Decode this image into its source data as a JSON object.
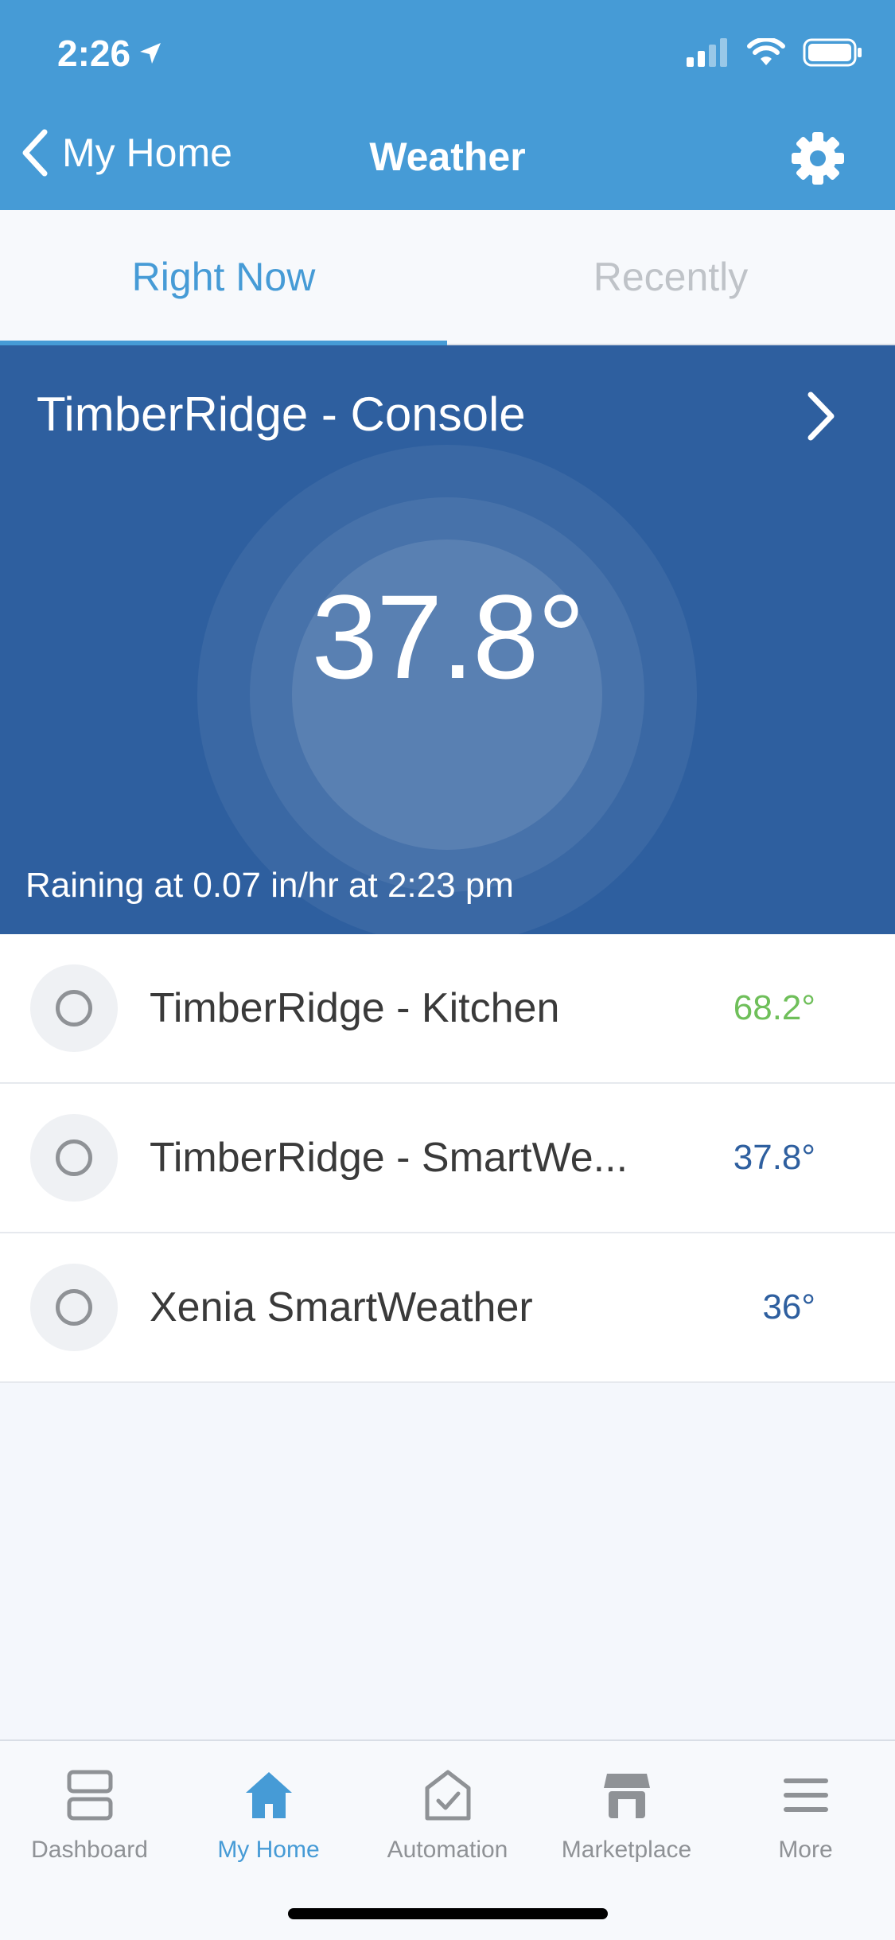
{
  "status": {
    "time": "2:26"
  },
  "nav": {
    "back_label": "My Home",
    "title": "Weather"
  },
  "tabs": {
    "active": "Right Now",
    "inactive": "Recently"
  },
  "hero": {
    "title": "TimberRidge - Console",
    "temperature": "37.8°",
    "status": "Raining at 0.07 in/hr at 2:23 pm"
  },
  "list": [
    {
      "name": "TimberRidge - Kitchen",
      "temp": "68.2°",
      "temp_color": "#6fbf5a"
    },
    {
      "name": "TimberRidge - SmartWe...",
      "temp": "37.8°",
      "temp_color": "#2e5f9f"
    },
    {
      "name": "Xenia SmartWeather",
      "temp": "36°",
      "temp_color": "#2e5f9f"
    }
  ],
  "tabbar": [
    {
      "label": "Dashboard",
      "icon": "dashboard-icon"
    },
    {
      "label": "My Home",
      "icon": "home-icon"
    },
    {
      "label": "Automation",
      "icon": "automation-icon"
    },
    {
      "label": "Marketplace",
      "icon": "marketplace-icon"
    },
    {
      "label": "More",
      "icon": "menu-icon"
    }
  ],
  "colors": {
    "header": "#469bd6",
    "hero": "#2e5f9f",
    "accent": "#469bd6"
  }
}
